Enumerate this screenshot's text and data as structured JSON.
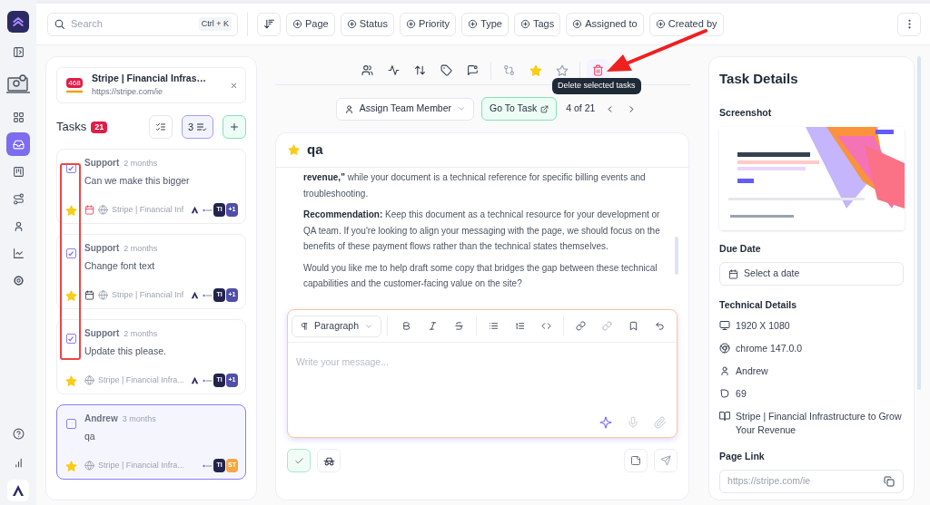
{
  "nav_items": [
    {
      "kind": "panel",
      "selected": false
    },
    {
      "kind": "laptop",
      "selected": false
    },
    {
      "kind": "grid",
      "selected": false
    },
    {
      "kind": "inbox",
      "selected": true
    },
    {
      "kind": "board",
      "selected": false
    },
    {
      "kind": "route",
      "selected": false
    },
    {
      "kind": "user",
      "selected": false
    },
    {
      "kind": "chart",
      "selected": false
    },
    {
      "kind": "settings",
      "selected": false
    }
  ],
  "nav_bottom": [
    {
      "kind": "help",
      "selected": false
    },
    {
      "kind": "bars",
      "selected": false
    }
  ],
  "search": {
    "placeholder": "Search",
    "shortcut": "Ctrl + K"
  },
  "filters": [
    "Page",
    "Status",
    "Priority",
    "Type",
    "Tags",
    "Assigned to",
    "Created by"
  ],
  "site": {
    "badge": "468",
    "title": "Stripe | Financial Infras…",
    "url": "https://stripe.com/ie"
  },
  "tasks": {
    "title": "Tasks",
    "count": "21",
    "selected_count": "3",
    "items": [
      {
        "author": "Support",
        "age": "2 months",
        "text": "Can we make this bigger",
        "checked": true,
        "starred": true,
        "selected": false,
        "due_date": true,
        "overdue": true,
        "site": "Stripe | Financial Inf",
        "avatars": [
          {
            "kind": "letter_logo"
          },
          {
            "kind": "wordmark"
          },
          {
            "kind": "initials",
            "label": "TI",
            "color": "#23234f"
          },
          {
            "kind": "initials",
            "label": "+1",
            "color": "#4f4fa8"
          }
        ]
      },
      {
        "author": "Support",
        "age": "2 months",
        "text": "Change font text",
        "checked": true,
        "starred": true,
        "selected": false,
        "due_date": true,
        "overdue": false,
        "site": "Stripe | Financial Inf",
        "avatars": [
          {
            "kind": "letter_logo"
          },
          {
            "kind": "wordmark"
          },
          {
            "kind": "initials",
            "label": "TI",
            "color": "#23234f"
          },
          {
            "kind": "initials",
            "label": "+1",
            "color": "#4f4fa8"
          }
        ]
      },
      {
        "author": "Support",
        "age": "2 months",
        "text": "Update this please.",
        "checked": true,
        "starred": true,
        "selected": false,
        "due_date": false,
        "site": "Stripe | Financial Infra...",
        "avatars": [
          {
            "kind": "letter_logo"
          },
          {
            "kind": "wordmark"
          },
          {
            "kind": "initials",
            "label": "TI",
            "color": "#23234f"
          },
          {
            "kind": "initials",
            "label": "+1",
            "color": "#4f4fa8"
          }
        ]
      },
      {
        "author": "Andrew",
        "age": "3 months",
        "text": "qa",
        "checked": false,
        "starred": true,
        "selected": true,
        "due_date": false,
        "site": "Stripe | Financial Infra...",
        "avatars": [
          {
            "kind": "wordmark"
          },
          {
            "kind": "initials",
            "label": "TI",
            "color": "#23234f"
          },
          {
            "kind": "initials",
            "label": "ST",
            "color": "#f5a742"
          }
        ]
      }
    ]
  },
  "toolbar": {
    "tooltip": "Delete selected tasks"
  },
  "navigator": {
    "assign": "Assign Team Member",
    "go_to": "Go To Task",
    "position": "4 of 21"
  },
  "conversation": {
    "title": "qa",
    "starred": true,
    "paragraphs": [
      "**revenue,\"** while your document is a technical reference for specific billing events and troubleshooting.",
      "**Recommendation:** Keep this document as a technical resource for your development or QA team. If you're looking to align your messaging with the page, we should focus on the benefits of these payment flows rather than the technical states themselves.",
      "Would you like me to help draft some copy that bridges the gap between these technical capabilities and the customer-facing value on the site?"
    ]
  },
  "editor": {
    "block_type": "Paragraph",
    "placeholder": "Write your message..."
  },
  "details": {
    "title": "Task Details",
    "screenshot_label": "Screenshot",
    "due_label": "Due Date",
    "due_placeholder": "Select a date",
    "tech_label": "Technical Details",
    "tech": [
      {
        "kind": "screen",
        "text": "1920 X 1080"
      },
      {
        "kind": "browser",
        "text": "chrome 147.0.0"
      },
      {
        "kind": "user",
        "text": "Andrew"
      },
      {
        "kind": "badge",
        "text": "69"
      },
      {
        "kind": "page",
        "text": "Stripe | Financial Infrastructure to Grow Your Revenue"
      }
    ],
    "link_label": "Page Link",
    "link": "https://stripe.com/ie"
  }
}
